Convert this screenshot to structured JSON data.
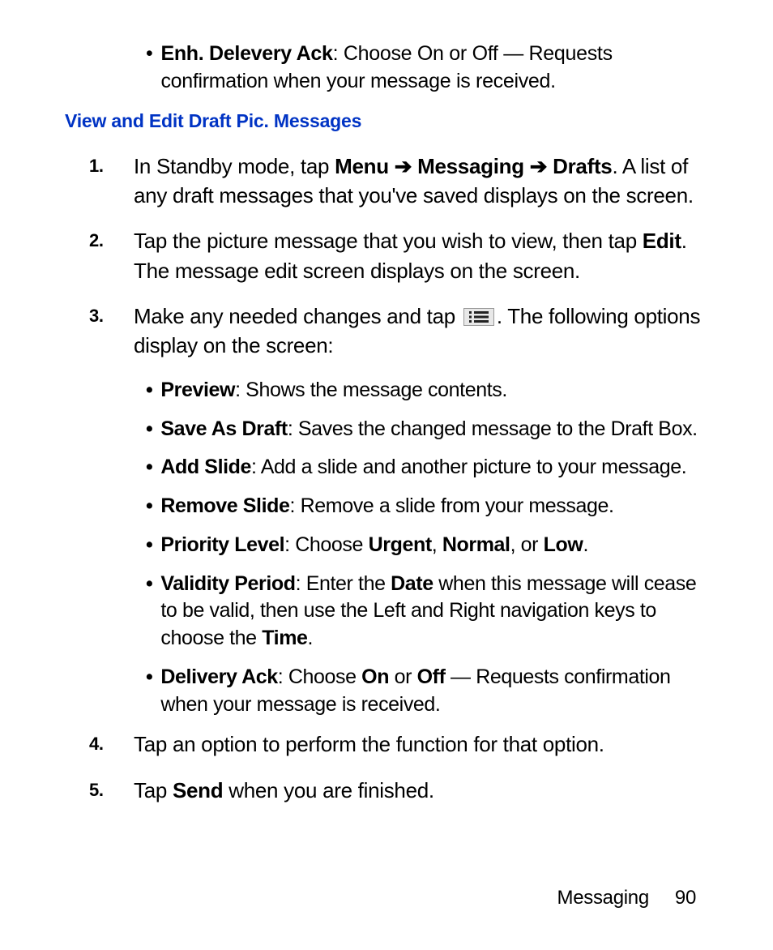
{
  "top_bullet": {
    "label": "Enh. Delevery Ack",
    "text": ": Choose On or Off — Requests confirmation when your message is received."
  },
  "heading": "View and Edit Draft Pic. Messages",
  "steps": {
    "s1": {
      "num": "1.",
      "pre": "In Standby mode, tap ",
      "b1": "Menu",
      "arrow1": " ➔ ",
      "b2": "Messaging",
      "arrow2": " ➔ ",
      "b3": "Drafts",
      "post": ". A list of any draft messages that you've saved displays on the screen."
    },
    "s2": {
      "num": "2.",
      "pre": "Tap the picture message that you wish to view, then tap ",
      "b1": "Edit",
      "post": ". The message edit screen displays on the screen."
    },
    "s3": {
      "num": "3.",
      "pre": "Make any needed changes and tap ",
      "post": ". The following options display on the screen:"
    },
    "s4": {
      "num": "4.",
      "text": "Tap an option to perform the function for that option."
    },
    "s5": {
      "num": "5.",
      "pre": "Tap ",
      "b1": "Send",
      "post": " when you are finished."
    }
  },
  "subs": {
    "preview": {
      "label": "Preview",
      "text": ": Shows the message contents."
    },
    "savedraft": {
      "label": "Save As Draft",
      "text": ": Saves the changed message to the Draft Box."
    },
    "addslide": {
      "label": "Add Slide",
      "text": ": Add a slide and another picture to your message."
    },
    "removeslide": {
      "label": "Remove Slide",
      "text": ": Remove a slide from your message."
    },
    "priority": {
      "label": "Priority Level",
      "pre": ": Choose ",
      "b1": "Urgent",
      "c1": ", ",
      "b2": "Normal",
      "c2": ", or ",
      "b3": "Low",
      "post": "."
    },
    "validity": {
      "label": "Validity Period",
      "pre": ": Enter the ",
      "b1": "Date",
      "mid": " when this message will cease to be valid, then use the Left and Right navigation keys to choose the ",
      "b2": "Time",
      "post": "."
    },
    "delivery": {
      "label": "Delivery Ack",
      "pre": ": Choose ",
      "b1": "On",
      "mid": " or ",
      "b2": "Off",
      "post": " — Requests confirmation when your message is received."
    }
  },
  "footer": {
    "section": "Messaging",
    "page": "90"
  }
}
